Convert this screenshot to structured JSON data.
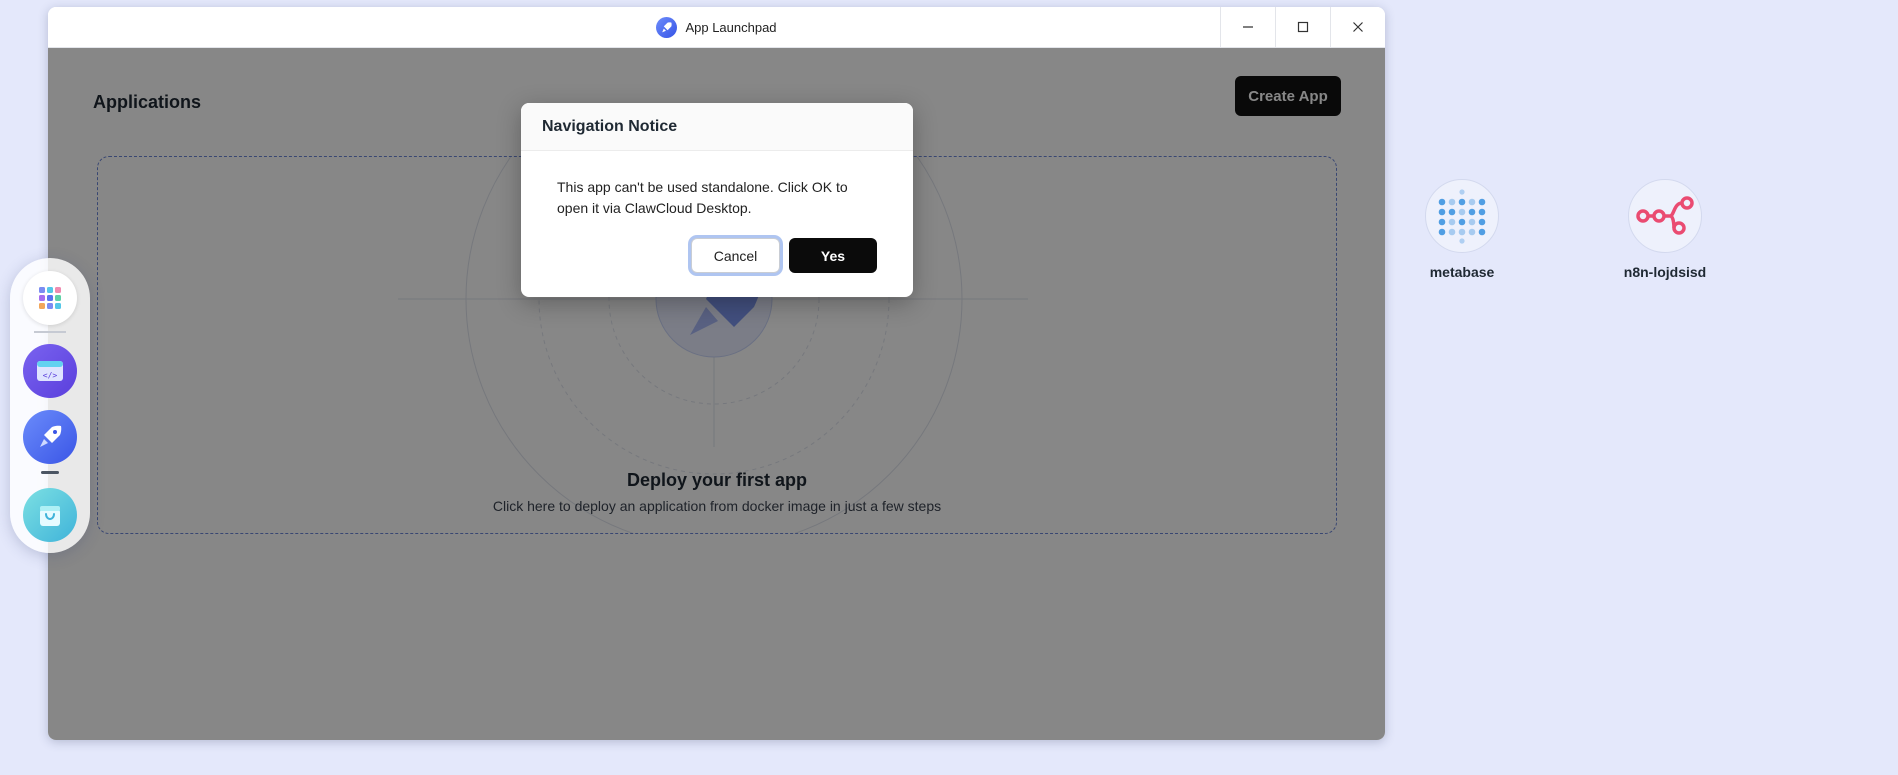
{
  "window": {
    "title": "App Launchpad",
    "icon": "rocket-icon",
    "controls": [
      "minimize-icon",
      "maximize-icon",
      "close-icon"
    ]
  },
  "page": {
    "title": "Applications",
    "create_button": "Create App"
  },
  "empty_state": {
    "title": "Deploy your first app",
    "subtitle": "Click here to deploy an application from docker image in just a few steps"
  },
  "modal": {
    "title": "Navigation Notice",
    "message": "This app can't be used standalone. Click OK to open it via ClawCloud Desktop.",
    "cancel_label": "Cancel",
    "confirm_label": "Yes"
  },
  "dock": {
    "items": [
      {
        "name": "app-grid-icon"
      },
      {
        "name": "devbox-code-icon"
      },
      {
        "name": "app-launchpad-rocket-icon",
        "active": true
      },
      {
        "name": "app-store-bag-icon"
      }
    ]
  },
  "desktop": {
    "icons": [
      {
        "label": "metabase",
        "icon": "metabase-icon",
        "color": "#509ee3"
      },
      {
        "label": "n8n-lojdsisd",
        "icon": "n8n-icon",
        "color": "#ea4b71"
      }
    ]
  },
  "colors": {
    "desktop_bg": "#e4e8fb",
    "overlay": "rgba(0,0,0,0.47)",
    "primary_button": "#111111",
    "accent": "#3553e6"
  }
}
